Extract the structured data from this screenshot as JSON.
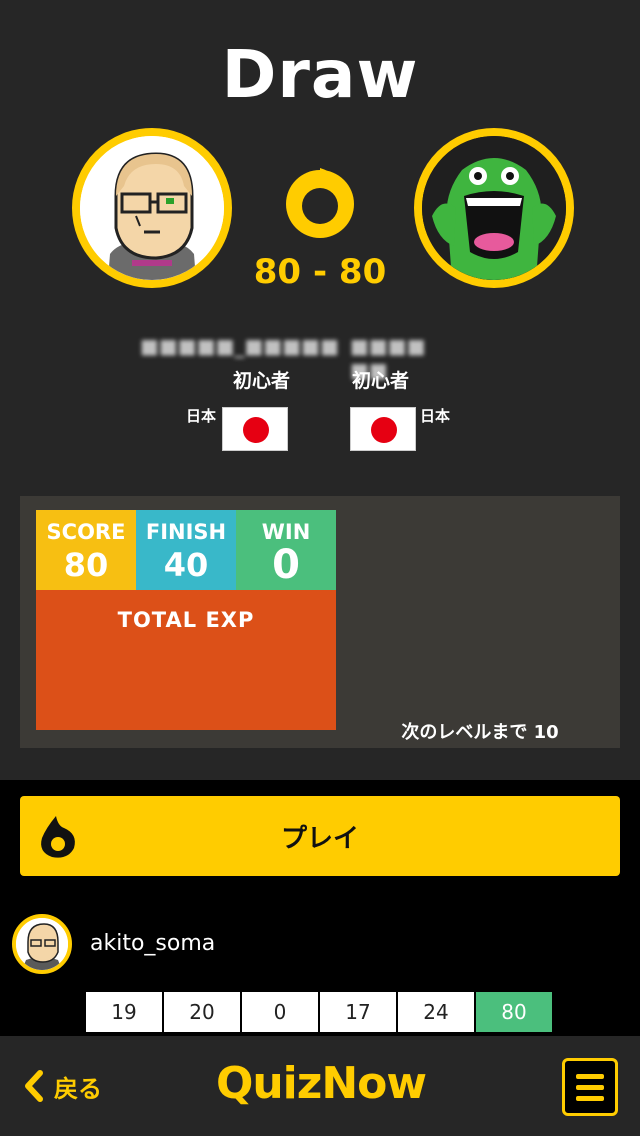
{
  "result": {
    "title": "Draw",
    "score_left": "80",
    "score_sep": "-",
    "score_right": "80"
  },
  "players": {
    "left": {
      "name": "■■■■■_■■■■■",
      "rank": "初心者",
      "country": "日本"
    },
    "right": {
      "name": "■■■■ ■■",
      "rank": "初心者",
      "country": "日本"
    }
  },
  "stats": {
    "score_label": "SCORE",
    "score_value": "80",
    "finish_label": "FINISH",
    "finish_value": "40",
    "win_label": "WIN",
    "win_value": "0",
    "total_label": "TOTAL  EXP",
    "next_level": "次のレベルまで  10"
  },
  "play_button": {
    "label": "プレイ"
  },
  "user": {
    "name": "akito_soma"
  },
  "history": [
    "19",
    "20",
    "0",
    "17",
    "24",
    "80"
  ],
  "nav": {
    "back_label": "戻る",
    "brand": "QuizNow",
    "menu_icon": "hamburger-menu-icon"
  },
  "colors": {
    "accent": "#ffcc00",
    "score": "#f7bf12",
    "finish": "#39b8c9",
    "win": "#4bbf7d",
    "total": "#dc5018"
  }
}
